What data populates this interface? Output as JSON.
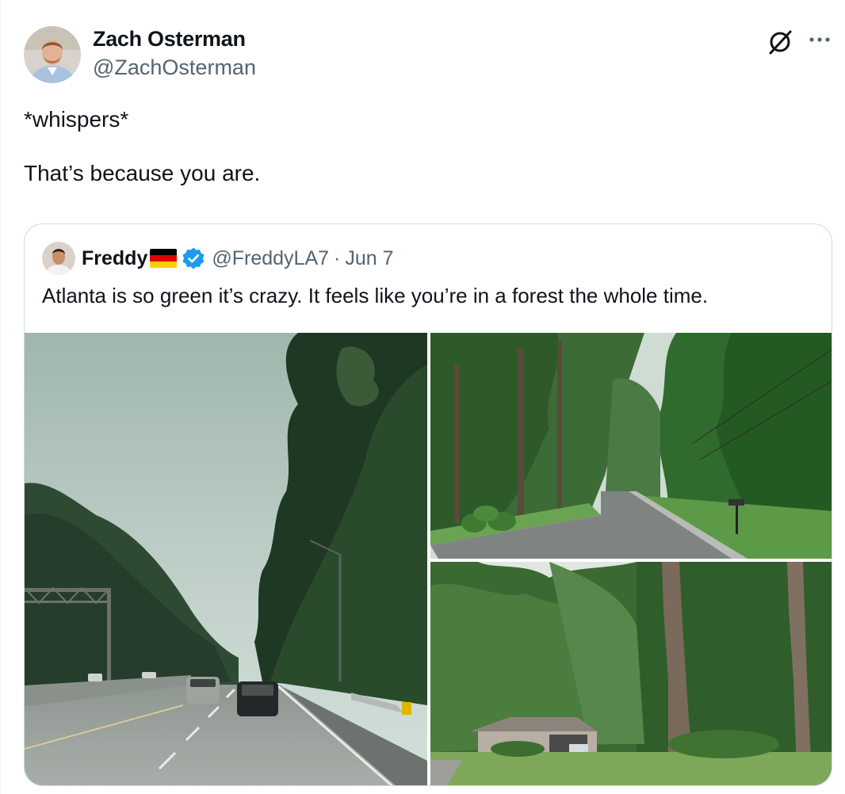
{
  "tweet": {
    "author": {
      "name": "Zach Osterman",
      "handle": "@ZachOsterman",
      "avatar_icon": "person-avatar"
    },
    "text": "*whispers*\n\nThat’s because you are.",
    "icons": [
      "grok-icon",
      "more-options-icon"
    ]
  },
  "quoted_tweet": {
    "author": {
      "name": "Freddy",
      "flag": "germany-flag",
      "verified": true,
      "verified_color": "#1d9bf0",
      "handle": "@FreddyLA7",
      "separator": "·",
      "date": "Jun 7"
    },
    "text": "Atlanta is so green it’s crazy. It feels like you’re in a forest the whole time.",
    "media": [
      {
        "name": "highway-through-trees-photo"
      },
      {
        "name": "suburban-road-with-pines-photo"
      },
      {
        "name": "house-in-woods-photo"
      }
    ]
  }
}
